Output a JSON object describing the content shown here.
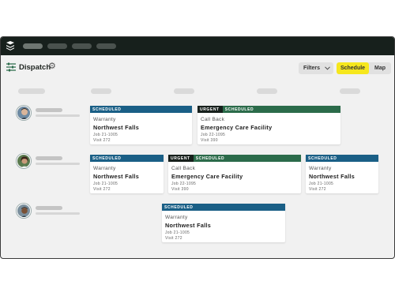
{
  "header": {
    "title": "Dispatch",
    "filters_label": "Filters",
    "views": [
      "Schedule",
      "Map"
    ],
    "active_view": "Schedule"
  },
  "colors": {
    "topbar": "#17201c",
    "scheduled_blue": "#1a5f86",
    "scheduled_green": "#2b6b4a",
    "urgent": "#17201c",
    "active_toggle": "#f6e71d"
  },
  "icons": {
    "app_logo": "layers-logo-icon",
    "dispatch": "sliders-icon",
    "settings": "gear-icon",
    "filters": "chevron-down-icon"
  },
  "rows": [
    {
      "cards": [
        {
          "urgent": "",
          "status": "SCHEDULED",
          "type": "Warranty",
          "name": "Northwest Falls",
          "job": "Job 21-1005",
          "visit": "Visit 272"
        },
        {
          "urgent": "URGENT",
          "status": "SCHEDULED",
          "type": "Call Back",
          "name": "Emergency Care Facility",
          "job": "Job 22-1095",
          "visit": "Visit 390"
        }
      ]
    },
    {
      "cards": [
        {
          "urgent": "",
          "status": "SCHEDULED",
          "type": "Warranty",
          "name": "Northwest Falls",
          "job": "Job 21-1005",
          "visit": "Visit 272"
        },
        {
          "urgent": "URGENT",
          "status": "SCHEDULED",
          "type": "Call Back",
          "name": "Emergency Care Facility",
          "job": "Job 22-1095",
          "visit": "Visit 390"
        },
        {
          "urgent": "",
          "status": "SCHEDULED",
          "type": "Warranty",
          "name": "Northwest Falls",
          "job": "Job 21-1005",
          "visit": "Visit 272"
        }
      ]
    },
    {
      "cards": [
        {
          "urgent": "",
          "status": "SCHEDULED",
          "type": "Warranty",
          "name": "Northwest Falls",
          "job": "Job 21-1005",
          "visit": "Visit 272"
        }
      ]
    }
  ]
}
